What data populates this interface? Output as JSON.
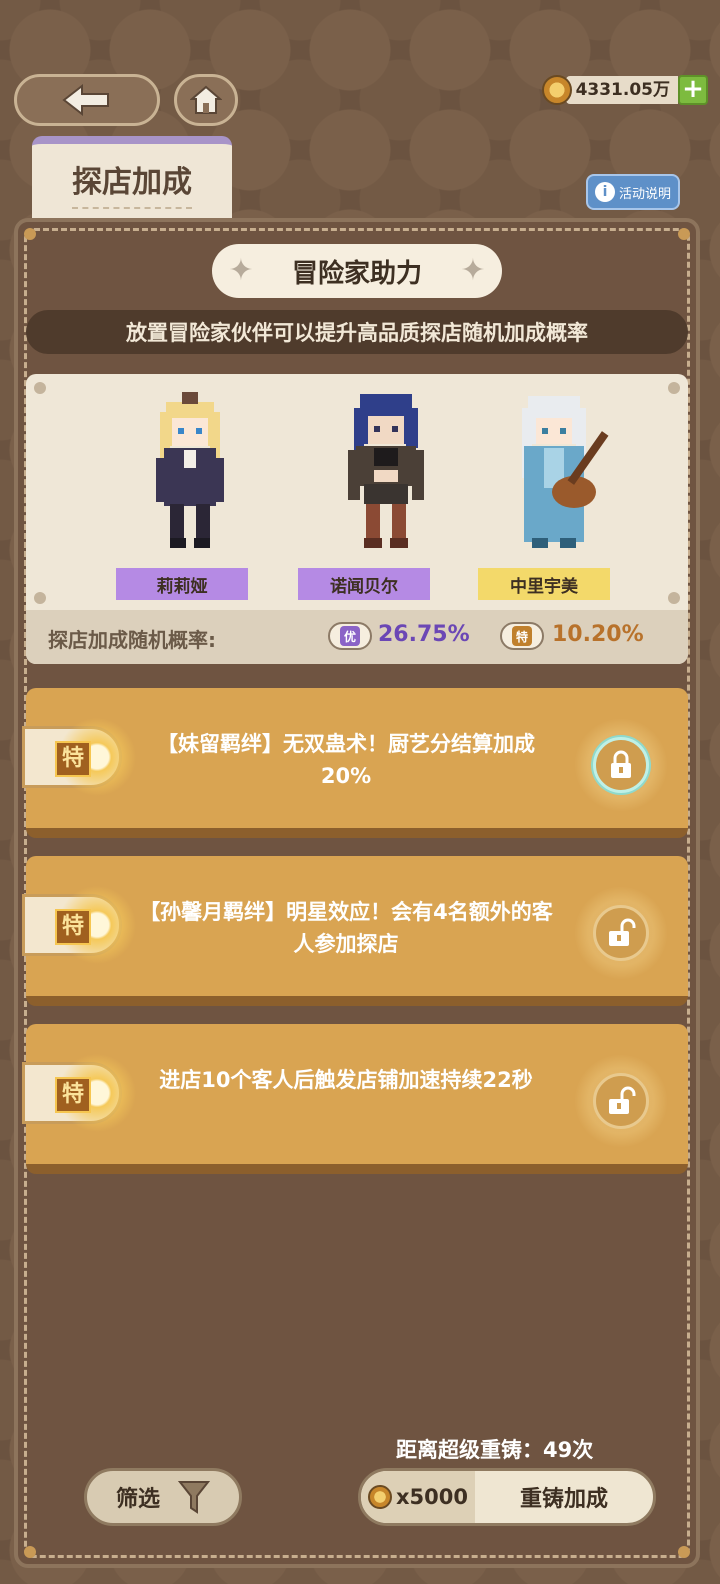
{
  "topbar": {
    "back_icon": "back-arrow-icon",
    "home_icon": "home-icon",
    "currency_value": "4331.05万",
    "plus_label": "+"
  },
  "tab": {
    "label": "探店加成"
  },
  "info_button": {
    "label": "活动说明"
  },
  "panel": {
    "title": "冒险家助力",
    "subtitle": "放置冒险家伙伴可以提升高品质探店随机加成概率"
  },
  "characters": [
    {
      "name": "莉莉娅",
      "label_color": "#b58ae4"
    },
    {
      "name": "诺闻贝尔",
      "label_color": "#b58ae4"
    },
    {
      "name": "中里宇美",
      "label_color": "#f3d96a"
    }
  ],
  "rates": {
    "title": "探店加成随机概率:",
    "items": [
      {
        "badge": "优",
        "badge_color": "#8b63c7",
        "value": "26.75%",
        "value_color": "#6b47b5"
      },
      {
        "badge": "特",
        "badge_color": "#c0802d",
        "value": "10.20%",
        "value_color": "#b8722b"
      }
    ]
  },
  "bonuses": [
    {
      "tag": "特",
      "text": "【妹留羁绊】无双蛊术！厨艺分结算加成20%",
      "lock_state": "locked"
    },
    {
      "tag": "特",
      "text": "【孙馨月羁绊】明星效应！会有4名额外的客人参加探店",
      "lock_state": "unlocked"
    },
    {
      "tag": "特",
      "text": "进店10个客人后触发店铺加速持续22秒",
      "lock_state": "unlocked"
    }
  ],
  "bottom": {
    "reforge_count": "距离超级重铸：49次",
    "filter_label": "筛选",
    "cost": "x5000",
    "reforge_label": "重铸加成"
  }
}
